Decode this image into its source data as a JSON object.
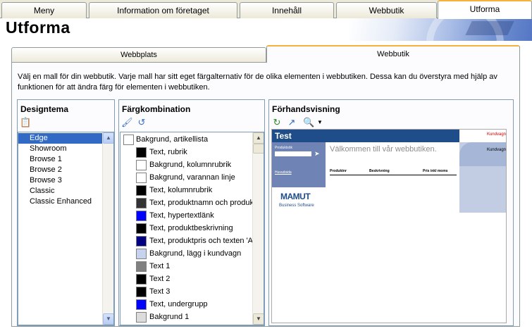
{
  "top_tabs": [
    "Meny",
    "Information om företaget",
    "Innehåll",
    "Webbutik",
    "Utforma"
  ],
  "page_title": "Utforma",
  "sub_tabs": [
    "Webbplats",
    "Webbutik"
  ],
  "intro_text": "Välj en mall för din webbutik. Varje mall har sitt eget färgalternativ för de olika elementen i webbutiken. Dessa kan du överstyra med hjälp av funktionen för att ändra färg för elementen i webbutiken.",
  "design_panel": {
    "title": "Designtema",
    "items": [
      "Edge",
      "Showroom",
      "Browse 1",
      "Browse 2",
      "Browse 3",
      "Classic",
      "Classic Enhanced"
    ],
    "selected": "Edge"
  },
  "color_panel": {
    "title": "Färgkombination",
    "items": [
      {
        "label": "Bakgrund, artikellista",
        "color": "#ffffff"
      },
      {
        "label": "Text, rubrik",
        "color": "#000000"
      },
      {
        "label": "Bakgrund, kolumnrubrik",
        "color": "#ffffff"
      },
      {
        "label": "Bakgrund, varannan linje",
        "color": "#ffffff"
      },
      {
        "label": "Text, kolumnrubrik",
        "color": "#000000"
      },
      {
        "label": "Text, produktnamn och produkt",
        "color": "#333333"
      },
      {
        "label": "Text, hypertextlänk",
        "color": "#0000ff"
      },
      {
        "label": "Text, produktbeskrivning",
        "color": "#000000"
      },
      {
        "label": "Text, produktpris och texten 'Ar",
        "color": "#000080"
      },
      {
        "label": "Bakgrund, lägg i kundvagn",
        "color": "#c6d3ef"
      },
      {
        "label": "Text 1",
        "color": "#808080"
      },
      {
        "label": "Text 2",
        "color": "#000000"
      },
      {
        "label": "Text 3",
        "color": "#000000"
      },
      {
        "label": "Text, undergrupp",
        "color": "#0000ff"
      },
      {
        "label": "Bakgrund 1",
        "color": "#dcdcdc"
      }
    ]
  },
  "preview_panel": {
    "title": "Förhandsvisning",
    "shop_title": "Test",
    "cart_link": "Kundvagn",
    "cart_label": "Kundvagn",
    "search_label": "Produktsök",
    "group_link": "Huvudsida",
    "welcome": "Välkommen till vår webbutiken.",
    "columns": [
      "Produktnr",
      "Beskrivning",
      "Pris inkl moms"
    ],
    "logo": "MAMUT",
    "logo_sub": "Business Software"
  },
  "colors": {
    "active_tab_accent": "#f6b13d",
    "selection": "#316ac5",
    "preview_header": "#1f4d8a"
  }
}
